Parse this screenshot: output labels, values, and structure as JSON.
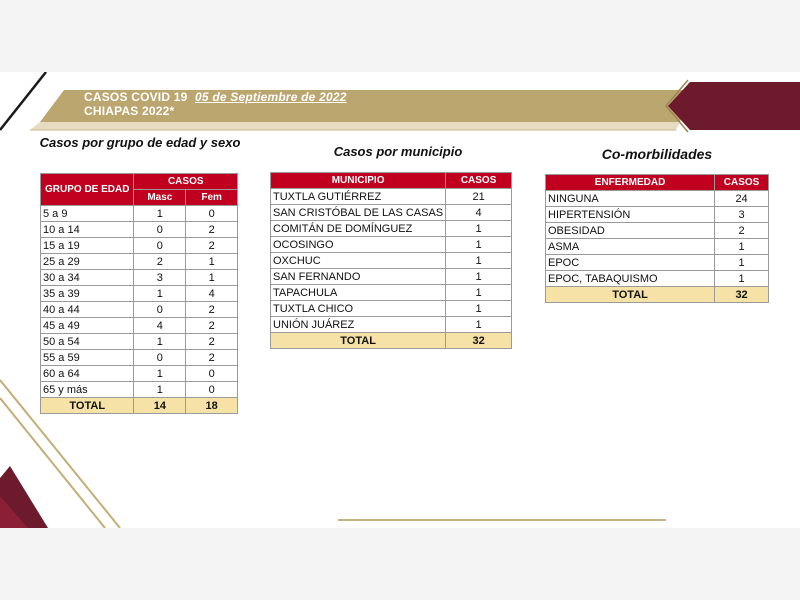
{
  "header": {
    "line1": "CASOS COVID 19",
    "date": "05 de Septiembre de 2022",
    "line2": "CHIAPAS 2022*"
  },
  "colors": {
    "maroon": "#6d1a2d",
    "gold": "#b49a5a",
    "red_header": "#c0001e",
    "total_row": "#f6e2a6"
  },
  "edad": {
    "title": "Casos por grupo de edad y sexo",
    "header_group": "GRUPO DE EDAD",
    "header_casos": "CASOS",
    "header_masc": "Masc",
    "header_fem": "Fem",
    "rows": [
      {
        "grupo": "5 a 9",
        "masc": "1",
        "fem": "0"
      },
      {
        "grupo": "10 a 14",
        "masc": "0",
        "fem": "2"
      },
      {
        "grupo": "15 a 19",
        "masc": "0",
        "fem": "2"
      },
      {
        "grupo": "25 a 29",
        "masc": "2",
        "fem": "1"
      },
      {
        "grupo": "30 a 34",
        "masc": "3",
        "fem": "1"
      },
      {
        "grupo": "35 a 39",
        "masc": "1",
        "fem": "4"
      },
      {
        "grupo": "40 a 44",
        "masc": "0",
        "fem": "2"
      },
      {
        "grupo": "45 a 49",
        "masc": "4",
        "fem": "2"
      },
      {
        "grupo": "50 a 54",
        "masc": "1",
        "fem": "2"
      },
      {
        "grupo": "55 a 59",
        "masc": "0",
        "fem": "2"
      },
      {
        "grupo": "60 a 64",
        "masc": "1",
        "fem": "0"
      },
      {
        "grupo": "65 y más",
        "masc": "1",
        "fem": "0"
      }
    ],
    "total_label": "TOTAL",
    "total_masc": "14",
    "total_fem": "18"
  },
  "municipio": {
    "title": "Casos por municipio",
    "header_municipio": "MUNICIPIO",
    "header_casos": "CASOS",
    "rows": [
      {
        "nombre": "TUXTLA GUTIÉRREZ",
        "casos": "21"
      },
      {
        "nombre": "SAN CRISTÓBAL DE LAS CASAS",
        "casos": "4"
      },
      {
        "nombre": "COMITÁN DE DOMÍNGUEZ",
        "casos": "1"
      },
      {
        "nombre": "OCOSINGO",
        "casos": "1"
      },
      {
        "nombre": "OXCHUC",
        "casos": "1"
      },
      {
        "nombre": "SAN FERNANDO",
        "casos": "1"
      },
      {
        "nombre": "TAPACHULA",
        "casos": "1"
      },
      {
        "nombre": "TUXTLA CHICO",
        "casos": "1"
      },
      {
        "nombre": "UNIÓN JUÁREZ",
        "casos": "1"
      }
    ],
    "total_label": "TOTAL",
    "total_casos": "32"
  },
  "comorbilidades": {
    "title": "Co-morbilidades",
    "header_enfermedad": "ENFERMEDAD",
    "header_casos": "CASOS",
    "rows": [
      {
        "nombre": "NINGUNA",
        "casos": "24"
      },
      {
        "nombre": "HIPERTENSIÓN",
        "casos": "3"
      },
      {
        "nombre": "OBESIDAD",
        "casos": "2"
      },
      {
        "nombre": "ASMA",
        "casos": "1"
      },
      {
        "nombre": "EPOC",
        "casos": "1"
      },
      {
        "nombre": "EPOC, TABAQUISMO",
        "casos": "1"
      }
    ],
    "total_label": "TOTAL",
    "total_casos": "32"
  }
}
